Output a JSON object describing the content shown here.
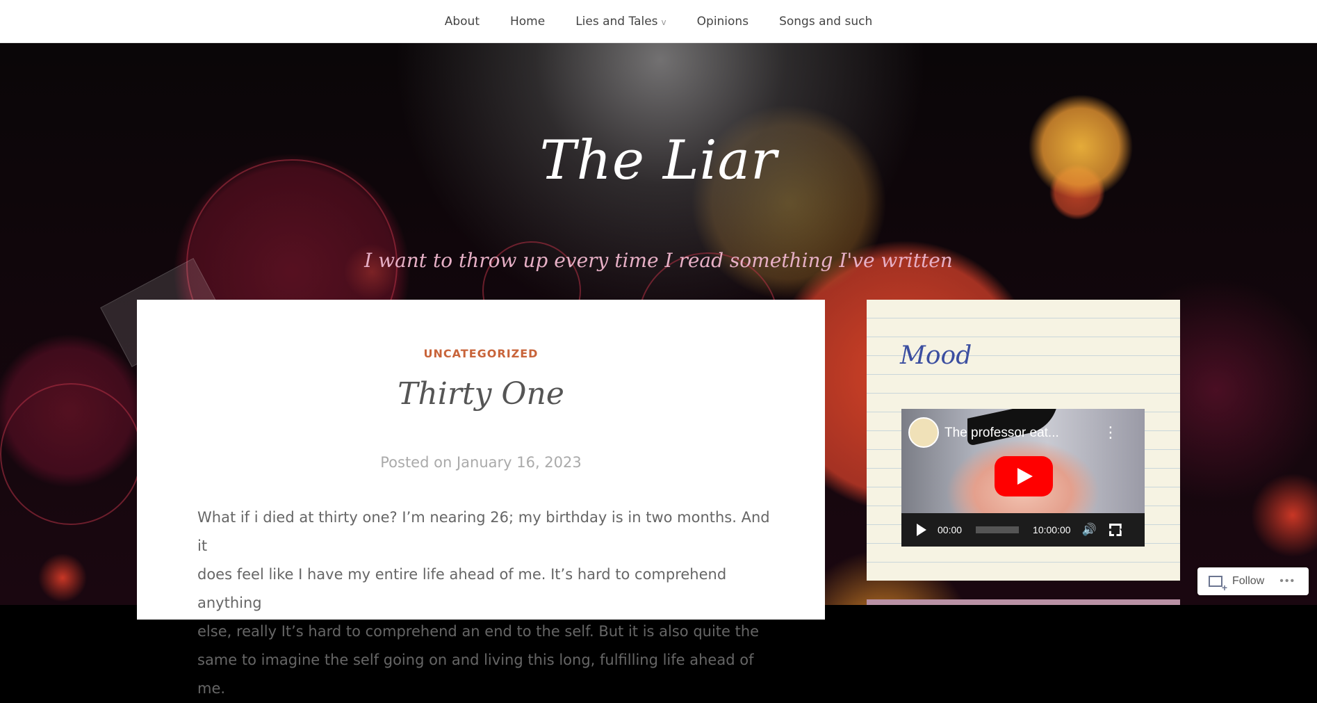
{
  "nav": {
    "items": [
      {
        "label": "About"
      },
      {
        "label": "Home"
      },
      {
        "label": "Lies and Tales",
        "has_dropdown": true,
        "caret": "v"
      },
      {
        "label": "Opinions"
      },
      {
        "label": "Songs and such"
      }
    ]
  },
  "site": {
    "title": "The Liar",
    "tagline": "I want to throw up every time I read something I've written"
  },
  "post": {
    "category": "UNCATEGORIZED",
    "title": "Thirty One",
    "posted_prefix": "Posted on",
    "date": "January 16, 2023",
    "body": [
      "What if i died at thirty one? I’m nearing 26; my birthday is in two months. And it",
      "does feel like I have my entire life ahead of me. It’s hard to comprehend anything",
      "else, really It’s hard to comprehend an end to the self. But it is also quite the",
      "same to imagine the self going on and living this long, fulfilling life ahead of me."
    ]
  },
  "widget": {
    "title": "Mood",
    "video": {
      "title": "The professor eat...",
      "more_icon": "⋮",
      "current_time": "00:00",
      "duration": "10:00:00",
      "progress": 0
    }
  },
  "follow": {
    "label": "Follow",
    "more": "•••"
  },
  "colors": {
    "category": "#c8643a",
    "widget_bg": "#f6f3e3",
    "widget_title": "#3b4ea0",
    "tagline": "#e7b0c6"
  }
}
